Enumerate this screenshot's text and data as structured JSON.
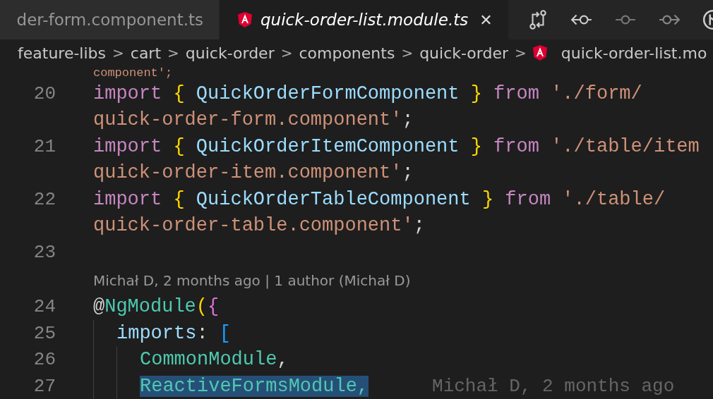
{
  "tabs": [
    {
      "label": "der-form.component.ts",
      "selected": false,
      "icon": false
    },
    {
      "label": "quick-order-list.module.ts",
      "selected": true,
      "icon": true,
      "close": "✕"
    }
  ],
  "breadcrumb": [
    {
      "label": "feature-libs",
      "icon": false
    },
    {
      "label": "cart",
      "icon": false
    },
    {
      "label": "quick-order",
      "icon": false
    },
    {
      "label": "components",
      "icon": false
    },
    {
      "label": "quick-order",
      "icon": false
    },
    {
      "label": "quick-order-list.mo",
      "icon": true
    }
  ],
  "breadcrumb_separator": ">",
  "code": [
    {
      "kind": "clipped",
      "visual_lines": [
        {
          "tokens": [
            {
              "t": "component';",
              "kind": "string"
            }
          ]
        }
      ]
    },
    {
      "kind": "code",
      "number": "20",
      "visual_lines": [
        {
          "tokens": [
            {
              "t": "import ",
              "kind": "keyword"
            },
            {
              "t": "{ ",
              "kind": "brace"
            },
            {
              "t": "QuickOrderFormComponent ",
              "kind": "variable"
            },
            {
              "t": "} ",
              "kind": "brace"
            },
            {
              "t": "from ",
              "kind": "keyword"
            },
            {
              "t": "'./form/",
              "kind": "string"
            }
          ]
        },
        {
          "tokens": [
            {
              "t": "quick-order-form.component'",
              "kind": "string"
            },
            {
              "t": ";",
              "kind": "plain"
            }
          ]
        }
      ]
    },
    {
      "kind": "code",
      "number": "21",
      "visual_lines": [
        {
          "tokens": [
            {
              "t": "import ",
              "kind": "keyword"
            },
            {
              "t": "{ ",
              "kind": "brace"
            },
            {
              "t": "QuickOrderItemComponent ",
              "kind": "variable"
            },
            {
              "t": "} ",
              "kind": "brace"
            },
            {
              "t": "from ",
              "kind": "keyword"
            },
            {
              "t": "'./table/item",
              "kind": "string"
            }
          ]
        },
        {
          "tokens": [
            {
              "t": "quick-order-item.component'",
              "kind": "string"
            },
            {
              "t": ";",
              "kind": "plain"
            }
          ]
        }
      ]
    },
    {
      "kind": "code",
      "number": "22",
      "visual_lines": [
        {
          "tokens": [
            {
              "t": "import ",
              "kind": "keyword"
            },
            {
              "t": "{ ",
              "kind": "brace"
            },
            {
              "t": "QuickOrderTableComponent ",
              "kind": "variable"
            },
            {
              "t": "} ",
              "kind": "brace"
            },
            {
              "t": "from ",
              "kind": "keyword"
            },
            {
              "t": "'./table/",
              "kind": "string"
            }
          ]
        },
        {
          "tokens": [
            {
              "t": "quick-order-table.component'",
              "kind": "string"
            },
            {
              "t": ";",
              "kind": "plain"
            }
          ]
        }
      ]
    },
    {
      "kind": "code",
      "number": "23"
    },
    {
      "kind": "blame",
      "text": "Michał D, 2 months ago | 1 author (Michał D)"
    },
    {
      "kind": "code",
      "number": "24",
      "visual_lines": [
        {
          "tokens": [
            {
              "t": "@",
              "kind": "plain"
            },
            {
              "t": "NgModule",
              "kind": "type"
            },
            {
              "t": "(",
              "kind": "brace"
            },
            {
              "t": "{",
              "kind": "paren"
            }
          ]
        }
      ],
      "children": [
        {
          "kind": "code",
          "number": "25",
          "visual_lines": [
            {
              "tokens": [
                {
                  "t": "imports",
                  "kind": "variable"
                },
                {
                  "t": ": ",
                  "kind": "plain"
                },
                {
                  "t": "[",
                  "kind": "bracket"
                }
              ]
            }
          ],
          "children": [
            {
              "kind": "code",
              "number": "26",
              "visual_lines": [
                {
                  "tokens": [
                    {
                      "t": "CommonModule",
                      "kind": "type"
                    },
                    {
                      "t": ",",
                      "kind": "plain"
                    }
                  ]
                }
              ]
            },
            {
              "kind": "code",
              "number": "27",
              "visual_lines": [
                {
                  "tokens": [
                    {
                      "t": "ReactiveFormsModule,",
                      "kind": "type",
                      "selected": true
                    }
                  ]
                }
              ],
              "inline_blame": "Michał D, 2 months ago"
            }
          ]
        }
      ]
    }
  ]
}
